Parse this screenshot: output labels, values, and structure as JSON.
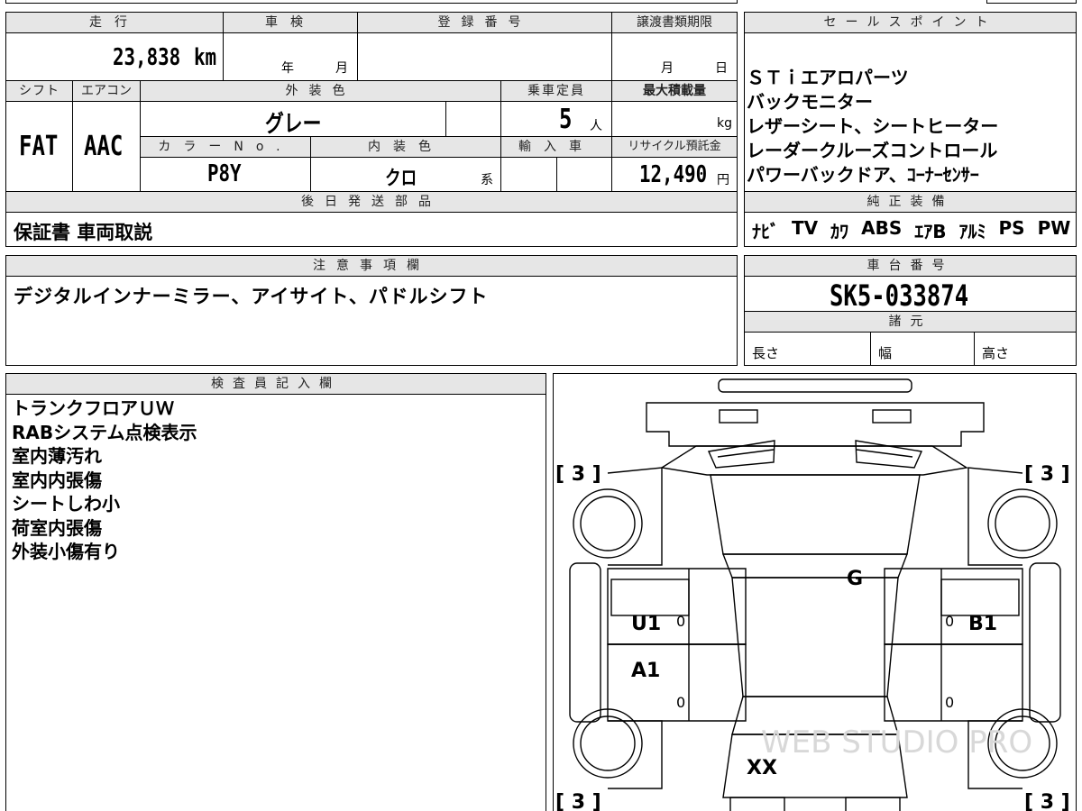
{
  "header": {
    "mileage_label": "走行",
    "shaken_label": "車検",
    "registration_label": "登録番号",
    "transfer_doc_label": "譲渡書類期限",
    "sales_point_label": "セールスポイント",
    "shift_label": "シフト",
    "aircon_label": "エアコン",
    "exterior_color_label": "外装色",
    "capacity_label": "乗車定員",
    "max_load_label": "最大積載量",
    "color_no_label": "カラーNo.",
    "interior_color_label": "内装色",
    "import_label": "輸入車",
    "recycle_label": "リサイクル預託金",
    "later_parts_label": "後日発送部品",
    "genuine_equipment_label": "純正装備",
    "notes_label": "注意事項欄",
    "chassis_label": "車台番号",
    "specs_label": "諸元",
    "inspector_label": "検査員記入欄"
  },
  "vehicle": {
    "mileage": "23,838",
    "mileage_unit": "km",
    "shaken_year_unit": "年",
    "shaken_month_unit": "月",
    "transfer_month_unit": "月",
    "transfer_day_unit": "日",
    "shift": "FAT",
    "aircon": "AAC",
    "exterior_color": "グレー",
    "capacity": "5",
    "capacity_unit": "人",
    "max_load_unit": "kg",
    "color_no": "P8Y",
    "interior_color": "クロ",
    "interior_suffix": "系",
    "recycle_fee": "12,490",
    "recycle_unit": "円",
    "later_parts": "保証書  車両取説",
    "chassis_no": "SK5-033874",
    "length_label": "長さ",
    "width_label": "幅",
    "height_label": "高さ"
  },
  "sales_points": [
    "ＳＴｉエアロパーツ",
    "バックモニター",
    "レザーシート、シートヒーター",
    "レーダークルーズコントロール",
    "パワーバックドア、ｺｰﾅｰｾﾝｻｰ"
  ],
  "equipment": [
    "ﾅﾋﾞ",
    "TV",
    "ｶﾜ",
    "ABS",
    "ｴｱB",
    "ｱﾙﾐ",
    "PS",
    "PW"
  ],
  "notes": "デジタルインナーミラー、アイサイト、パドルシフト",
  "inspector_notes": [
    "トランクフロアＵＷ",
    "RABシステム点検表示",
    "室内薄汚れ",
    "室内内張傷",
    "シートしわ小",
    "荷室内張傷",
    "外装小傷有り"
  ],
  "diagram": {
    "tire_front_left": "[ 3 ]",
    "tire_front_right": "[ 3 ]",
    "tire_rear_left": "[ 3 ]",
    "tire_rear_right": "[ 3 ]",
    "mark_g": "G",
    "mark_u1": "U1",
    "mark_a1": "A1",
    "mark_b1": "B1",
    "mark_xx": "XX",
    "zero_1": "0",
    "zero_2": "0",
    "zero_3": "0",
    "zero_4": "0",
    "watermark": "WEB STUDIO PRO"
  }
}
